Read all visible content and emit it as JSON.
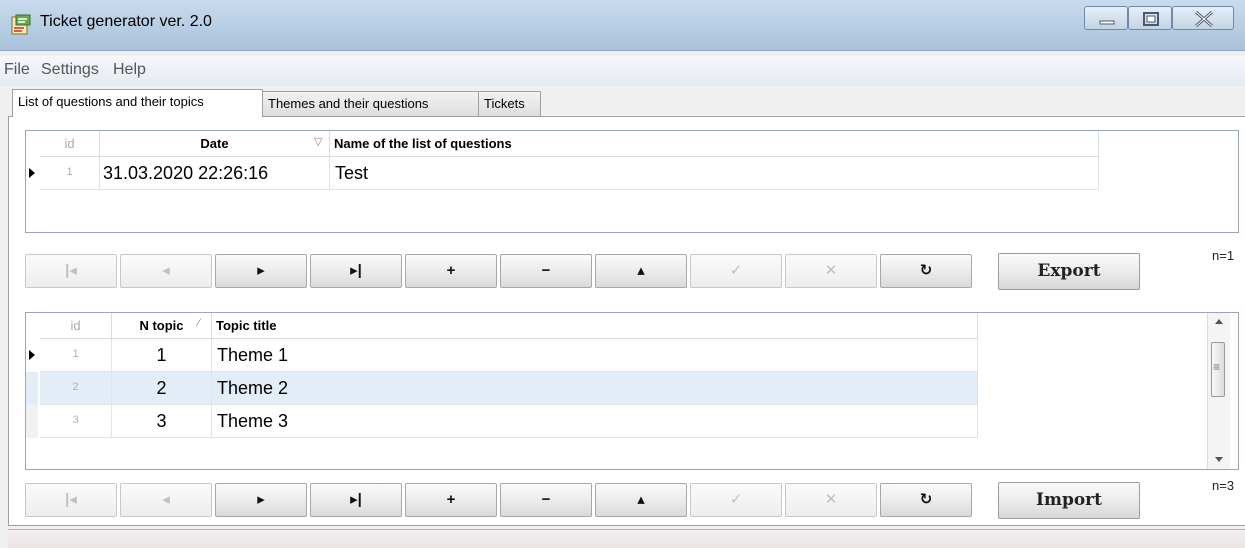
{
  "window": {
    "title": "Ticket generator ver. 2.0"
  },
  "menu": [
    "File",
    "Settings",
    "Help"
  ],
  "tabs": [
    "List of questions and their topics",
    "Themes and their questions",
    "Tickets"
  ],
  "questions_grid": {
    "headers": {
      "id": "id",
      "date": "Date",
      "name": "Name of the list of questions"
    },
    "rows": [
      {
        "id": "1",
        "date": "31.03.2020 22:26:16",
        "name": "Test"
      }
    ],
    "count_label": "n=1",
    "action_button": "Export"
  },
  "topics_grid": {
    "headers": {
      "id": "id",
      "n_topic": "N topic",
      "title": "Topic title"
    },
    "rows": [
      {
        "id": "1",
        "n": "1",
        "title": "Theme 1"
      },
      {
        "id": "2",
        "n": "2",
        "title": "Theme 2"
      },
      {
        "id": "3",
        "n": "3",
        "title": "Theme 3"
      }
    ],
    "count_label": "n=3",
    "action_button": "Import"
  },
  "navigator_buttons": [
    {
      "name": "first",
      "glyph": "|◂",
      "enabled": false
    },
    {
      "name": "prior",
      "glyph": "◂",
      "enabled": false
    },
    {
      "name": "next",
      "glyph": "▸",
      "enabled": true
    },
    {
      "name": "last",
      "glyph": "▸|",
      "enabled": true
    },
    {
      "name": "insert",
      "glyph": "+",
      "enabled": true
    },
    {
      "name": "delete",
      "glyph": "−",
      "enabled": true
    },
    {
      "name": "edit",
      "glyph": "▴",
      "enabled": true
    },
    {
      "name": "post",
      "glyph": "✓",
      "enabled": false
    },
    {
      "name": "cancel",
      "glyph": "✕",
      "enabled": false
    },
    {
      "name": "refresh",
      "glyph": "↻",
      "enabled": true
    }
  ],
  "colors": {
    "titlebar": "#b7cde3",
    "selected_row": "#e2edf8"
  }
}
